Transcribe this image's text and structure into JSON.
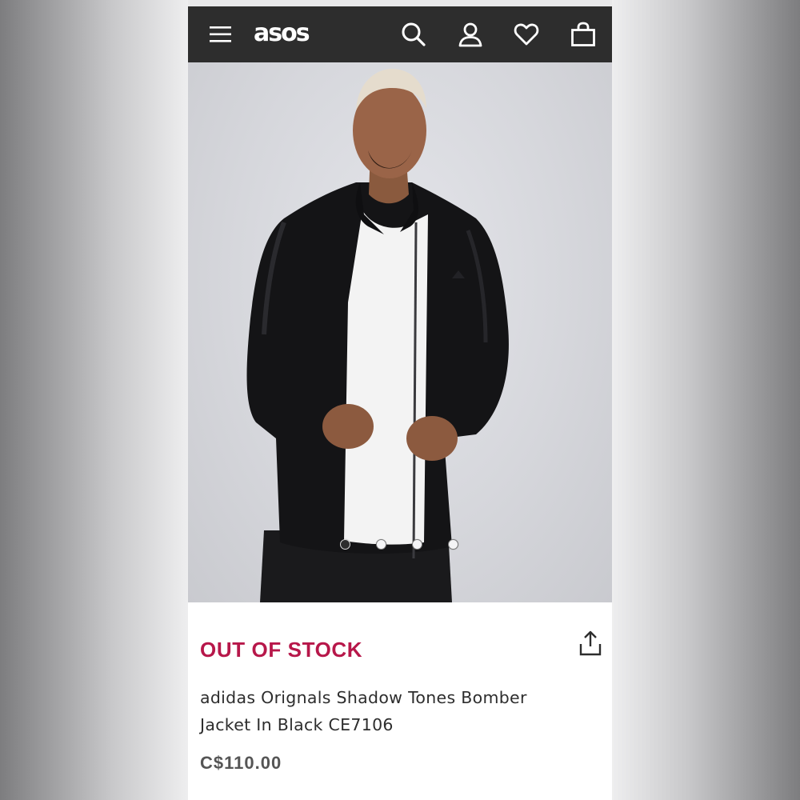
{
  "header": {
    "logo_text": "asos",
    "icons": [
      "menu-icon",
      "search-icon",
      "account-icon",
      "heart-icon",
      "bag-icon"
    ],
    "background": "#2d2d2d"
  },
  "gallery": {
    "image_description": "Model wearing black bomber jacket over white t-shirt",
    "slide_count": 4,
    "active_slide": 1
  },
  "product": {
    "stock_status": "OUT OF STOCK",
    "name_line1": "adidas Orignals Shadow Tones Bomber",
    "name_line2": "Jacket In Black CE7106",
    "price": "C$110.00",
    "status_color": "#b7174a"
  }
}
